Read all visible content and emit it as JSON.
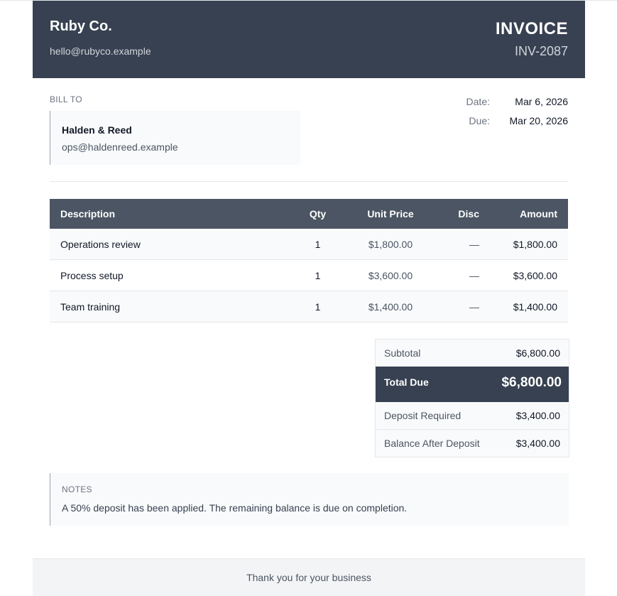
{
  "company": {
    "name": "Ruby Co.",
    "email": "hello@rubyco.example"
  },
  "invoice": {
    "title": "INVOICE",
    "number": "INV-2087"
  },
  "bill_to": {
    "label": "BILL TO",
    "name": "Halden & Reed",
    "email": "ops@haldenreed.example"
  },
  "meta": {
    "date_label": "Date:",
    "date_value": "Mar 6, 2026",
    "due_label": "Due:",
    "due_value": "Mar 20, 2026"
  },
  "table": {
    "headers": {
      "description": "Description",
      "qty": "Qty",
      "unit_price": "Unit Price",
      "disc": "Disc",
      "amount": "Amount"
    },
    "rows": [
      {
        "description": "Operations review",
        "qty": "1",
        "unit_price": "$1,800.00",
        "disc": "—",
        "amount": "$1,800.00"
      },
      {
        "description": "Process setup",
        "qty": "1",
        "unit_price": "$3,600.00",
        "disc": "—",
        "amount": "$3,600.00"
      },
      {
        "description": "Team training",
        "qty": "1",
        "unit_price": "$1,400.00",
        "disc": "—",
        "amount": "$1,400.00"
      }
    ]
  },
  "totals": {
    "subtotal_label": "Subtotal",
    "subtotal_value": "$6,800.00",
    "total_label": "Total Due",
    "total_value": "$6,800.00",
    "deposit_label": "Deposit Required",
    "deposit_value": "$3,400.00",
    "balance_label": "Balance After Deposit",
    "balance_value": "$3,400.00"
  },
  "notes": {
    "label": "NOTES",
    "text": "A 50% deposit has been applied. The remaining balance is due on completion."
  },
  "footer": {
    "text": "Thank you for your business"
  },
  "colors": {
    "header_bg": "#374151",
    "table_header_bg": "#4b5563",
    "panel_bg": "#f9fafb"
  }
}
